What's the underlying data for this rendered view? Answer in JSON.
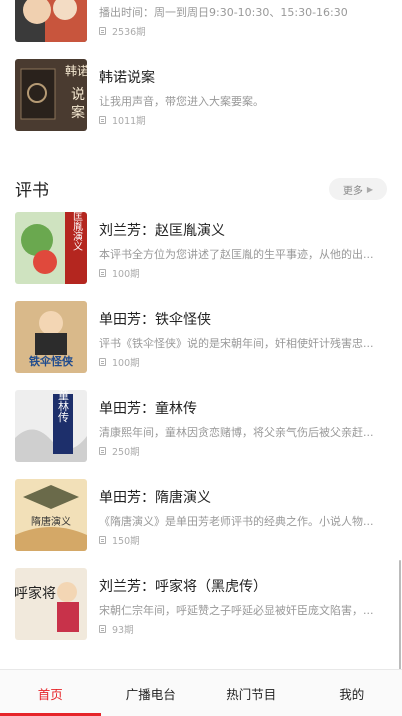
{
  "broadcast": [
    {
      "title": "",
      "desc": "播出时间：周一到周日9:30-10:30、15:30-16:30",
      "count": "2536期"
    },
    {
      "title": "韩诺说案",
      "desc": "让我用声音，带您进入大案要案。",
      "count": "1011期",
      "cover_text": [
        "韩诺",
        "说",
        "案"
      ]
    }
  ],
  "section": {
    "title": "评书",
    "more_label": "更多",
    "more_icon": "chevron-right-icon"
  },
  "items": [
    {
      "title": "刘兰芳：赵匡胤演义",
      "desc": "本评书全方位为您讲述了赵匡胤的生平事迹，从他的出...",
      "count": "100期",
      "cover_text": "赵匡胤演义"
    },
    {
      "title": "单田芳：铁伞怪侠",
      "desc": "评书《铁伞怪侠》说的是宋朝年间，奸相使奸计残害忠...",
      "count": "100期",
      "cover_text": "铁伞怪侠"
    },
    {
      "title": "单田芳：童林传",
      "desc": "清康熙年间，童林因贪恋赌博，将父亲气伤后被父亲赶...",
      "count": "250期",
      "cover_text": "童林传"
    },
    {
      "title": "单田芳：隋唐演义",
      "desc": "《隋唐演义》是单田芳老师评书的经典之作。小说人物...",
      "count": "150期",
      "cover_text": "隋唐演义"
    },
    {
      "title": "刘兰芳：呼家将（黑虎传）",
      "desc": "宋朝仁宗年间，呼延赞之子呼延必显被奸臣庞文陷害，...",
      "count": "93期",
      "cover_text": "呼家将"
    }
  ],
  "tabs": [
    {
      "label": "首页",
      "active": true
    },
    {
      "label": "广播电台",
      "active": false
    },
    {
      "label": "热门节目",
      "active": false
    },
    {
      "label": "我的",
      "active": false
    }
  ],
  "colors": {
    "accent": "#e62429",
    "text": "#222222",
    "muted": "#999999"
  }
}
